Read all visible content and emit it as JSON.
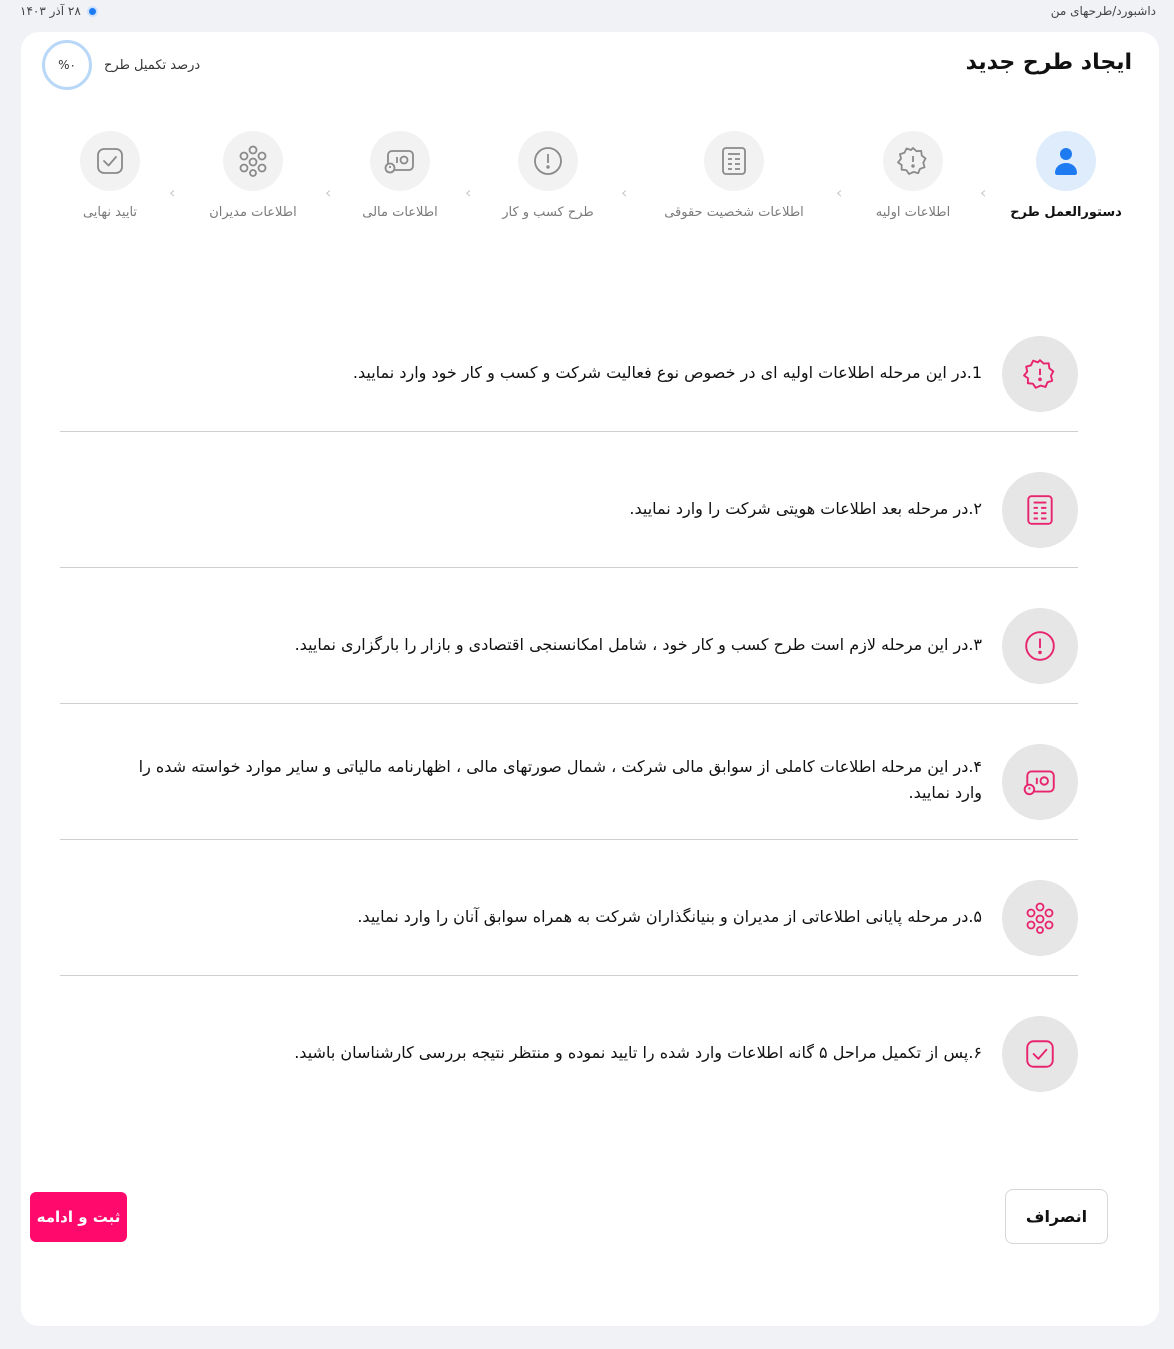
{
  "topbar": {
    "breadcrumb": "داشبورد/طرحهای من",
    "date": "۲۸ آذر ۱۴۰۳"
  },
  "header": {
    "title": "ایجاد طرح جدید",
    "progress_label": "درصد تکمیل طرح",
    "progress_value": "%۰",
    "progress_fraction": 0
  },
  "steps": [
    {
      "label": "دستورالعمل طرح",
      "icon": "user-icon",
      "active": true
    },
    {
      "label": "اطلاعات اولیه",
      "icon": "badge-alert-icon",
      "active": false
    },
    {
      "label": "اطلاعات شخصیت حقوقی",
      "icon": "document-icon",
      "active": false
    },
    {
      "label": "طرح کسب و کار",
      "icon": "alert-circle-icon",
      "active": false
    },
    {
      "label": "اطلاعات مالی",
      "icon": "money-icon",
      "active": false
    },
    {
      "label": "اطلاعات مدیران",
      "icon": "people-icon",
      "active": false
    },
    {
      "label": "تایید نهایی",
      "icon": "check-square-icon",
      "active": false
    }
  ],
  "instructions": [
    {
      "text": "1.در این مرحله اطلاعات اولیه ای در خصوص نوع فعالیت شرکت و کسب و کار خود وارد نمایید.",
      "icon": "badge-alert-icon"
    },
    {
      "text": "۲.در مرحله بعد اطلاعات هویتی شرکت را وارد نمایید.",
      "icon": "document-icon"
    },
    {
      "text": "۳.در این مرحله لازم است طرح کسب و کار خود ، شامل امکانسنجی اقتصادی و بازار را بارگزاری نمایید.",
      "icon": "alert-circle-icon"
    },
    {
      "text": "۴.در این مرحله اطلاعات کاملی از سوابق مالی شرکت ، شمال صورتهای مالی ، اظهارنامه مالیاتی و سایر موارد خواسته شده را وارد نمایید.",
      "icon": "money-icon"
    },
    {
      "text": "۵.در مرحله پایانی اطلاعاتی از مدیران و بنیانگذاران شرکت به همراه سوابق آنان را وارد نمایید.",
      "icon": "people-icon"
    },
    {
      "text": "۶.پس از تکمیل مراحل ۵ گانه اطلاعات وارد شده را تایید نموده و منتظر نتیجه بررسی کارشناسان باشید.",
      "icon": "check-square-icon"
    }
  ],
  "actions": {
    "cancel_label": "انصراف",
    "submit_label": "ثبت و ادامه"
  },
  "colors": {
    "accent_pink": "#ff0a6c",
    "active_blue": "#1e7bf2",
    "icon_pink": "#e8246e"
  }
}
